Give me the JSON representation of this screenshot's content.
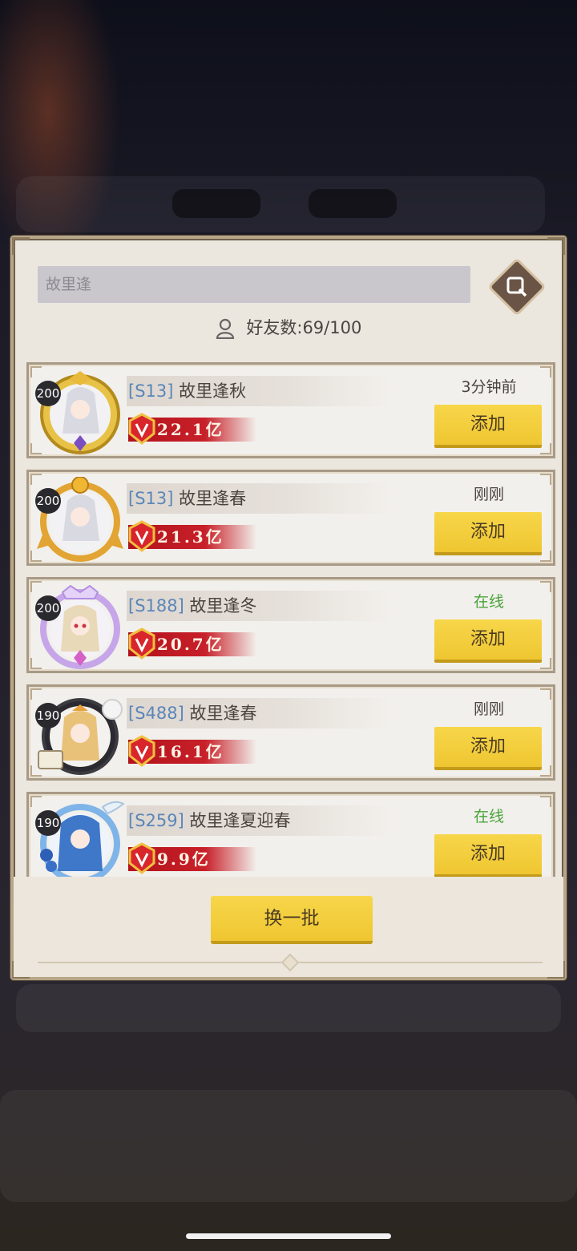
{
  "search": {
    "placeholder": "故里逢"
  },
  "friend_count": {
    "label": "好友数:",
    "value": "69/100"
  },
  "friends": [
    {
      "level": "200",
      "server": "[S13]",
      "name": "故里逢秋",
      "power": "22.1亿",
      "status": "3分钟前",
      "online": false,
      "add_label": "添加"
    },
    {
      "level": "200",
      "server": "[S13]",
      "name": "故里逢春",
      "power": "21.3亿",
      "status": "刚刚",
      "online": false,
      "add_label": "添加"
    },
    {
      "level": "200",
      "server": "[S188]",
      "name": "故里逢冬",
      "power": "20.7亿",
      "status": "在线",
      "online": true,
      "add_label": "添加"
    },
    {
      "level": "190",
      "server": "[S488]",
      "name": "故里逢春",
      "power": "16.1亿",
      "status": "刚刚",
      "online": false,
      "add_label": "添加"
    },
    {
      "level": "190",
      "server": "[S259]",
      "name": "故里逢夏迎春",
      "power": "9.9亿",
      "status": "在线",
      "online": true,
      "add_label": "添加"
    }
  ],
  "refresh_label": "换一批",
  "colors": {
    "accent_yellow": "#f2cc3a",
    "online_green": "#4aa33a",
    "server_blue": "#5a86b8",
    "power_red": "#c8202a"
  }
}
